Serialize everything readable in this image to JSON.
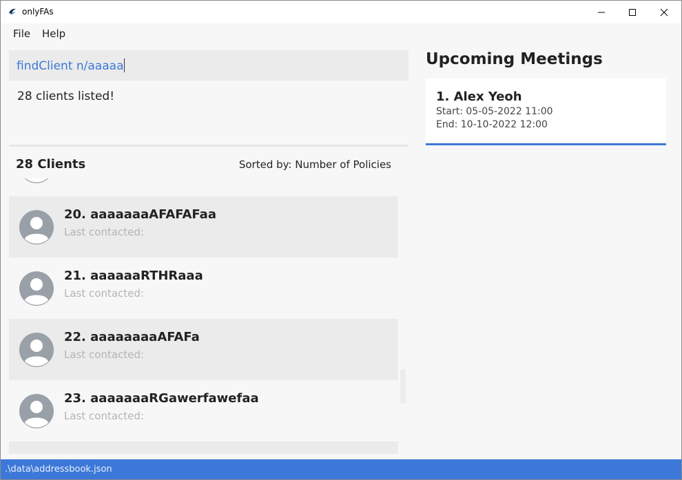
{
  "window": {
    "title": "onlyFAs"
  },
  "menu": {
    "file": "File",
    "help": "Help"
  },
  "command": {
    "value": "findClient n/aaaaa"
  },
  "result": {
    "message": "28 clients listed!"
  },
  "client_list": {
    "count_label": "28 Clients",
    "sort_label": "Sorted by: Number of Policies",
    "cards": [
      {
        "title": "20.  aaaaaaaAFAFAFaa",
        "subtitle": "Last contacted:"
      },
      {
        "title": "21.  aaaaaaRTHRaaa",
        "subtitle": "Last contacted:"
      },
      {
        "title": "22.  aaaaaaaaAFAFa",
        "subtitle": "Last contacted:"
      },
      {
        "title": "23.  aaaaaaaRGawerfawefaa",
        "subtitle": "Last contacted:"
      }
    ]
  },
  "meetings": {
    "title": "Upcoming Meetings",
    "items": [
      {
        "name": "1.  Alex Yeoh",
        "start": "Start: 05-05-2022 11:00",
        "end": "End: 10-10-2022 12:00"
      }
    ]
  },
  "status_bar": {
    "path": ".\\data\\addressbook.json"
  },
  "colors": {
    "accent": "#3b78d8",
    "card_alt": "#ebebeb",
    "background": "#f7f7f7",
    "muted_text": "#b4b4b4"
  },
  "icons": {
    "app": "app-logo-icon",
    "avatar": "user-avatar-icon",
    "minimize": "minimize-icon",
    "maximize": "maximize-icon",
    "close": "close-icon"
  }
}
